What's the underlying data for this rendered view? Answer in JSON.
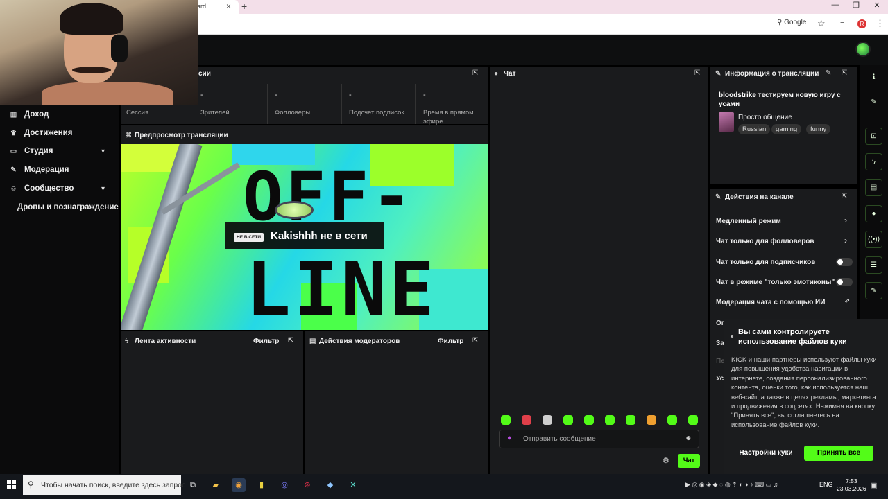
{
  "browser": {
    "tab_title": "ard",
    "tab_close": "×",
    "new_tab": "+",
    "window_buttons": [
      "—",
      "❐",
      "✕"
    ],
    "search_engine_chip": "Google",
    "profile_initial": "R"
  },
  "sidebar": {
    "items": [
      {
        "label": "Доход",
        "icon": "chart-icon"
      },
      {
        "label": "Достижения",
        "icon": "trophy-icon"
      },
      {
        "label": "Студия",
        "icon": "studio-icon"
      },
      {
        "label": "Модерация",
        "icon": "wrench-icon"
      },
      {
        "label": "Сообщество",
        "icon": "people-icon"
      }
    ],
    "sub_item": "Дропы и вознаграждение"
  },
  "session_panel": {
    "title_partial": "сии",
    "stats": [
      {
        "value": "-",
        "label": "Сессия"
      },
      {
        "value": "-",
        "label": "Зрителей"
      },
      {
        "value": "-",
        "label": "Фолловеры"
      },
      {
        "value": "-",
        "label": "Подсчет подписок"
      },
      {
        "value": "-",
        "label": "Время в прямом эфире"
      }
    ]
  },
  "preview": {
    "title": "Предпросмотр трансляции",
    "big_text_line1": "OFF-",
    "big_text_line2": "LINE",
    "badge": "НЕ В СЕТИ",
    "offline_message": "Kakishhh не в сети"
  },
  "activity": {
    "title": "Лента активности",
    "filter": "Фильтр"
  },
  "mod_actions": {
    "title": "Действия модераторов",
    "filter": "Фильтр"
  },
  "chat": {
    "title": "Чат",
    "placeholder": "Отправить сообщение",
    "send": "Чат",
    "emote_colors": [
      "#53fc18",
      "#e0404a",
      "#cfcfcf",
      "#53fc18",
      "#53fc18",
      "#53fc18",
      "#53fc18",
      "#f0a030",
      "#53fc18",
      "#53fc18"
    ]
  },
  "stream_info": {
    "title": "Информация о трансляции",
    "stream_title": "bloodstrike тестируем новую игру с усами",
    "category": "Просто общение",
    "tags": [
      "Russian",
      "gaming",
      "funny"
    ]
  },
  "channel_actions": {
    "title": "Действия на канале",
    "items": [
      {
        "label": "Медленный режим",
        "control": "chevron"
      },
      {
        "label": "Чат только для фолловеров",
        "control": "chevron"
      },
      {
        "label": "Чат только для подписчиков",
        "control": "toggle",
        "on": false
      },
      {
        "label": "Чат в режиме \"только эмотиконы\"",
        "control": "toggle",
        "on": false
      },
      {
        "label": "Модерация чата с помощью ИИ",
        "control": "external"
      }
    ],
    "cut_labels": [
      "Ог",
      "За",
      "Пе",
      "Ус"
    ]
  },
  "cookie": {
    "title": "Вы сами контролируете использование файлов куки",
    "body": "KICK и наши партнеры используют файлы куки для повышения удобства навигации в интернете, создания персонализированного контента, оценки того, как используется наш веб-сайт, а также в целях рекламы, маркетинга и продвижения в соцсетях. Нажимая на кнопку \"Принять все\", вы соглашаетесь на использование файлов куки.",
    "settings": "Настройки куки",
    "accept": "Принять все"
  },
  "rail": {
    "icons": [
      "info-icon",
      "edit-icon",
      "screen-icon",
      "bolt-icon",
      "document-icon",
      "chat-icon",
      "broadcast-icon",
      "stack-icon",
      "wrench-icon"
    ]
  },
  "taskbar": {
    "search_placeholder": "Чтобы начать поиск, введите здесь запрос",
    "lang": "ENG",
    "time": "7:53",
    "date": "23.03.2026"
  },
  "colors": {
    "accent": "#53fc18",
    "panel": "#1a1b1d",
    "background": "#000000"
  }
}
